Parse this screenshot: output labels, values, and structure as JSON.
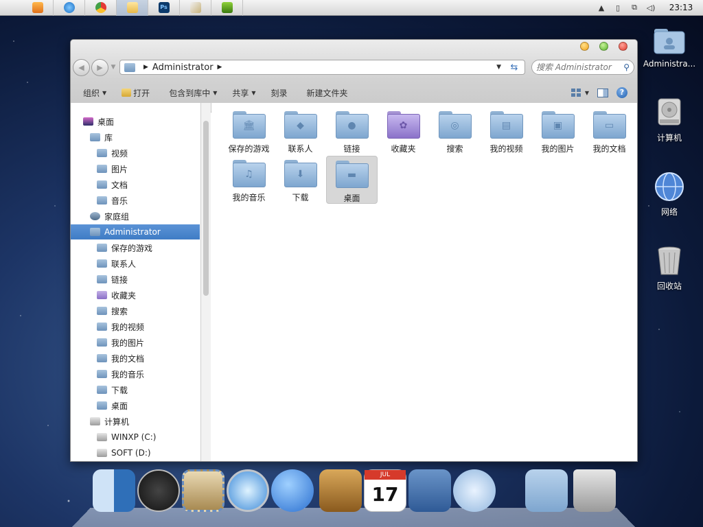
{
  "menubar": {
    "apps": [
      "Media Player",
      "Internet Explorer",
      "Chrome",
      "Explorer",
      "Photoshop",
      "Pen Tool",
      "NVIDIA"
    ],
    "clock": "23:13"
  },
  "desktop": {
    "icons": [
      {
        "label": "Administra..."
      },
      {
        "label": "计算机"
      },
      {
        "label": "网络"
      },
      {
        "label": "回收站"
      }
    ]
  },
  "window": {
    "address": {
      "path": "Administrator"
    },
    "search": {
      "placeholder": "搜索 Administrator"
    },
    "toolbar": {
      "organize": "组织",
      "open": "打开",
      "include_in_library": "包含到库中",
      "share": "共享",
      "burn": "刻录",
      "new_folder": "新建文件夹"
    },
    "navpane": {
      "items": [
        {
          "label": "桌面",
          "icon": "mac",
          "level": 0
        },
        {
          "label": "库",
          "icon": "library",
          "level": 1
        },
        {
          "label": "视频",
          "icon": "folder",
          "level": 2
        },
        {
          "label": "图片",
          "icon": "folder",
          "level": 2
        },
        {
          "label": "文档",
          "icon": "folder",
          "level": 2
        },
        {
          "label": "音乐",
          "icon": "folder",
          "level": 2
        },
        {
          "label": "家庭组",
          "icon": "group",
          "level": 1
        },
        {
          "label": "Administrator",
          "icon": "user",
          "level": 1,
          "selected": true
        },
        {
          "label": "保存的游戏",
          "icon": "folder",
          "level": 2
        },
        {
          "label": "联系人",
          "icon": "folder",
          "level": 2
        },
        {
          "label": "链接",
          "icon": "folder",
          "level": 2
        },
        {
          "label": "收藏夹",
          "icon": "purple",
          "level": 2
        },
        {
          "label": "搜索",
          "icon": "folder",
          "level": 2
        },
        {
          "label": "我的视频",
          "icon": "folder",
          "level": 2
        },
        {
          "label": "我的图片",
          "icon": "folder",
          "level": 2
        },
        {
          "label": "我的文档",
          "icon": "folder",
          "level": 2
        },
        {
          "label": "我的音乐",
          "icon": "folder",
          "level": 2
        },
        {
          "label": "下载",
          "icon": "folder",
          "level": 2
        },
        {
          "label": "桌面",
          "icon": "folder",
          "level": 2
        },
        {
          "label": "计算机",
          "icon": "drive",
          "level": 1
        },
        {
          "label": "WINXP (C:)",
          "icon": "drive",
          "level": 2
        },
        {
          "label": "SOFT (D:)",
          "icon": "drive",
          "level": 2
        }
      ]
    },
    "files": [
      {
        "label": "保存的游戏",
        "emblem": "🏛"
      },
      {
        "label": "联系人",
        "emblem": "◆"
      },
      {
        "label": "链接",
        "emblem": "●"
      },
      {
        "label": "收藏夹",
        "emblem": "✿",
        "purple": true
      },
      {
        "label": "搜索",
        "emblem": "◎"
      },
      {
        "label": "我的视频",
        "emblem": "▤"
      },
      {
        "label": "我的图片",
        "emblem": "▣"
      },
      {
        "label": "我的文档",
        "emblem": "▭"
      },
      {
        "label": "我的音乐",
        "emblem": "♫"
      },
      {
        "label": "下载",
        "emblem": "⬇"
      },
      {
        "label": "桌面",
        "emblem": "▬",
        "selected": true
      }
    ]
  },
  "dock": {
    "items": [
      "Finder",
      "Dashboard",
      "Mail",
      "Safari",
      "iChat",
      "Address Book",
      "iCal",
      "iPhoto",
      "iTunes",
      "Downloads",
      "Trash"
    ],
    "ical_month": "JUL",
    "ical_day": "17"
  }
}
